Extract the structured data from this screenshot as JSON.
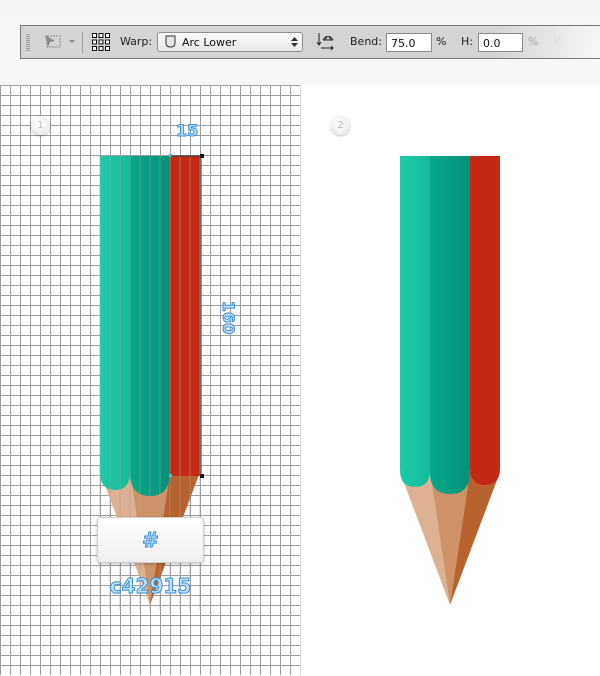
{
  "toolbar": {
    "warp_label": "Warp:",
    "warp_value": "Arc Lower",
    "bend_label": "Bend:",
    "bend_value": "75.0",
    "bend_unit": "%",
    "h_label": "H:",
    "h_value": "0.0",
    "h_unit": "%",
    "v_label": "V:"
  },
  "steps": [
    {
      "number": "1"
    },
    {
      "number": "2"
    }
  ],
  "dimensions": {
    "width_label": "15",
    "height_label": "160"
  },
  "color_tooltip": "# c42915",
  "colors": {
    "teal_light": "#1fc7a3",
    "teal_dark": "#05a386",
    "red": "#c42915",
    "wood_light": "#deb290",
    "wood_mid": "#cf9267",
    "wood_dark": "#b8622e"
  }
}
